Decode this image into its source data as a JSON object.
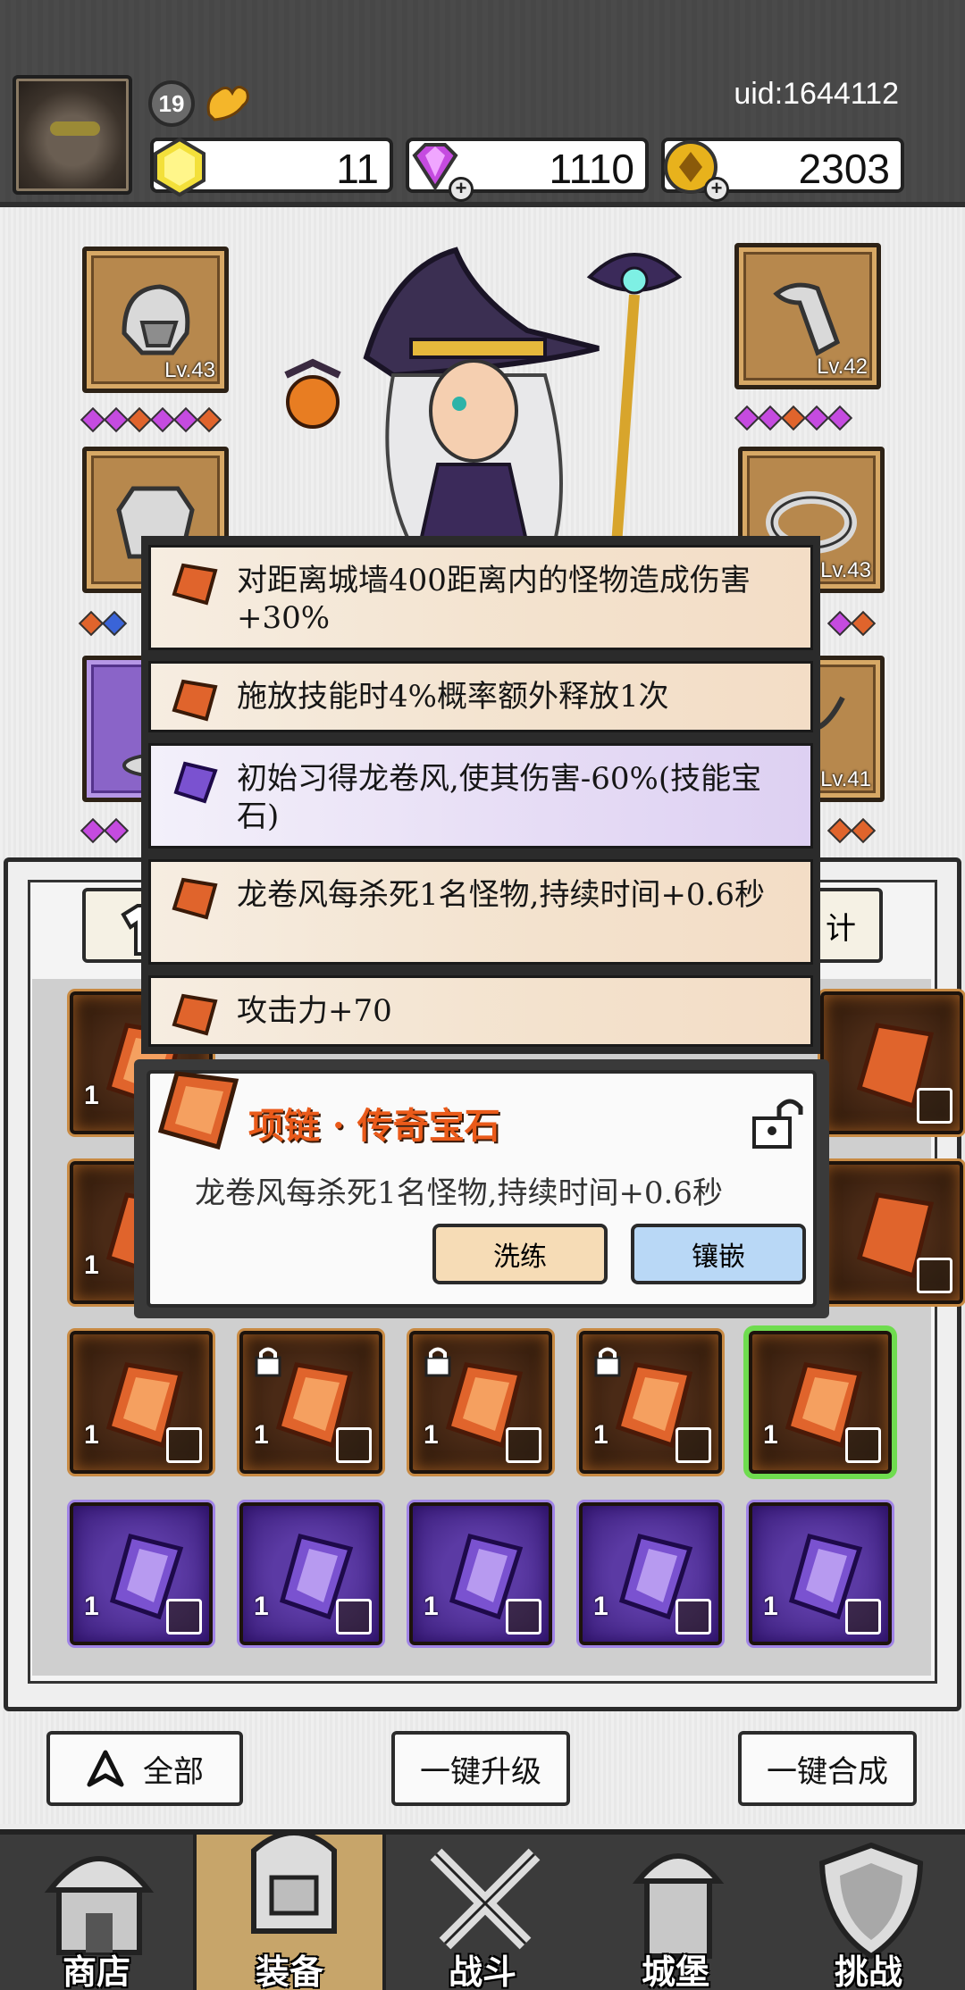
{
  "player": {
    "level": "19",
    "uid": "uid:1644112"
  },
  "currencies": {
    "energy": "11",
    "diamonds": "1110",
    "gold": "2303"
  },
  "equipment": {
    "slots": [
      {
        "name": "helmet",
        "level": "Lv.43"
      },
      {
        "name": "gauntlet",
        "level": "Lv.42"
      },
      {
        "name": "armor",
        "level": ""
      },
      {
        "name": "ring",
        "level": "Lv.43"
      },
      {
        "name": "boots",
        "level": ""
      },
      {
        "name": "necklace",
        "level": "Lv.41"
      }
    ]
  },
  "tabs": {
    "right_partial": "计"
  },
  "affixes": [
    {
      "text": "对距离城墙400距离内的怪物造成伤害+30%",
      "gem": "orange"
    },
    {
      "text": "施放技能时4%概率额外释放1次",
      "gem": "orange"
    },
    {
      "text": "初始习得龙卷风,使其伤害-60%(技能宝石)",
      "gem": "purple"
    },
    {
      "text": "龙卷风每杀死1名怪物,持续时间+0.6秒",
      "gem": "orange"
    },
    {
      "text": "攻击力+70",
      "gem": "orange"
    }
  ],
  "gem_detail": {
    "title": "项链 · 传奇宝石",
    "description": "龙卷风每杀死1名怪物,持续时间+0.6秒",
    "refine_label": "洗练",
    "inlay_label": "镶嵌"
  },
  "inventory": {
    "count_label": "1"
  },
  "actions": {
    "all_label": "全部",
    "upgrade_all_label": "一键升级",
    "merge_all_label": "一键合成"
  },
  "nav": {
    "shop": "商店",
    "equipment": "装备",
    "battle": "战斗",
    "castle": "城堡",
    "challenge": "挑战"
  },
  "colors": {
    "orange_gem": "#e0642c",
    "purple_gem": "#7a52d0",
    "selected_outline": "#6fdc4f",
    "title_orange": "#ea5a1a"
  }
}
